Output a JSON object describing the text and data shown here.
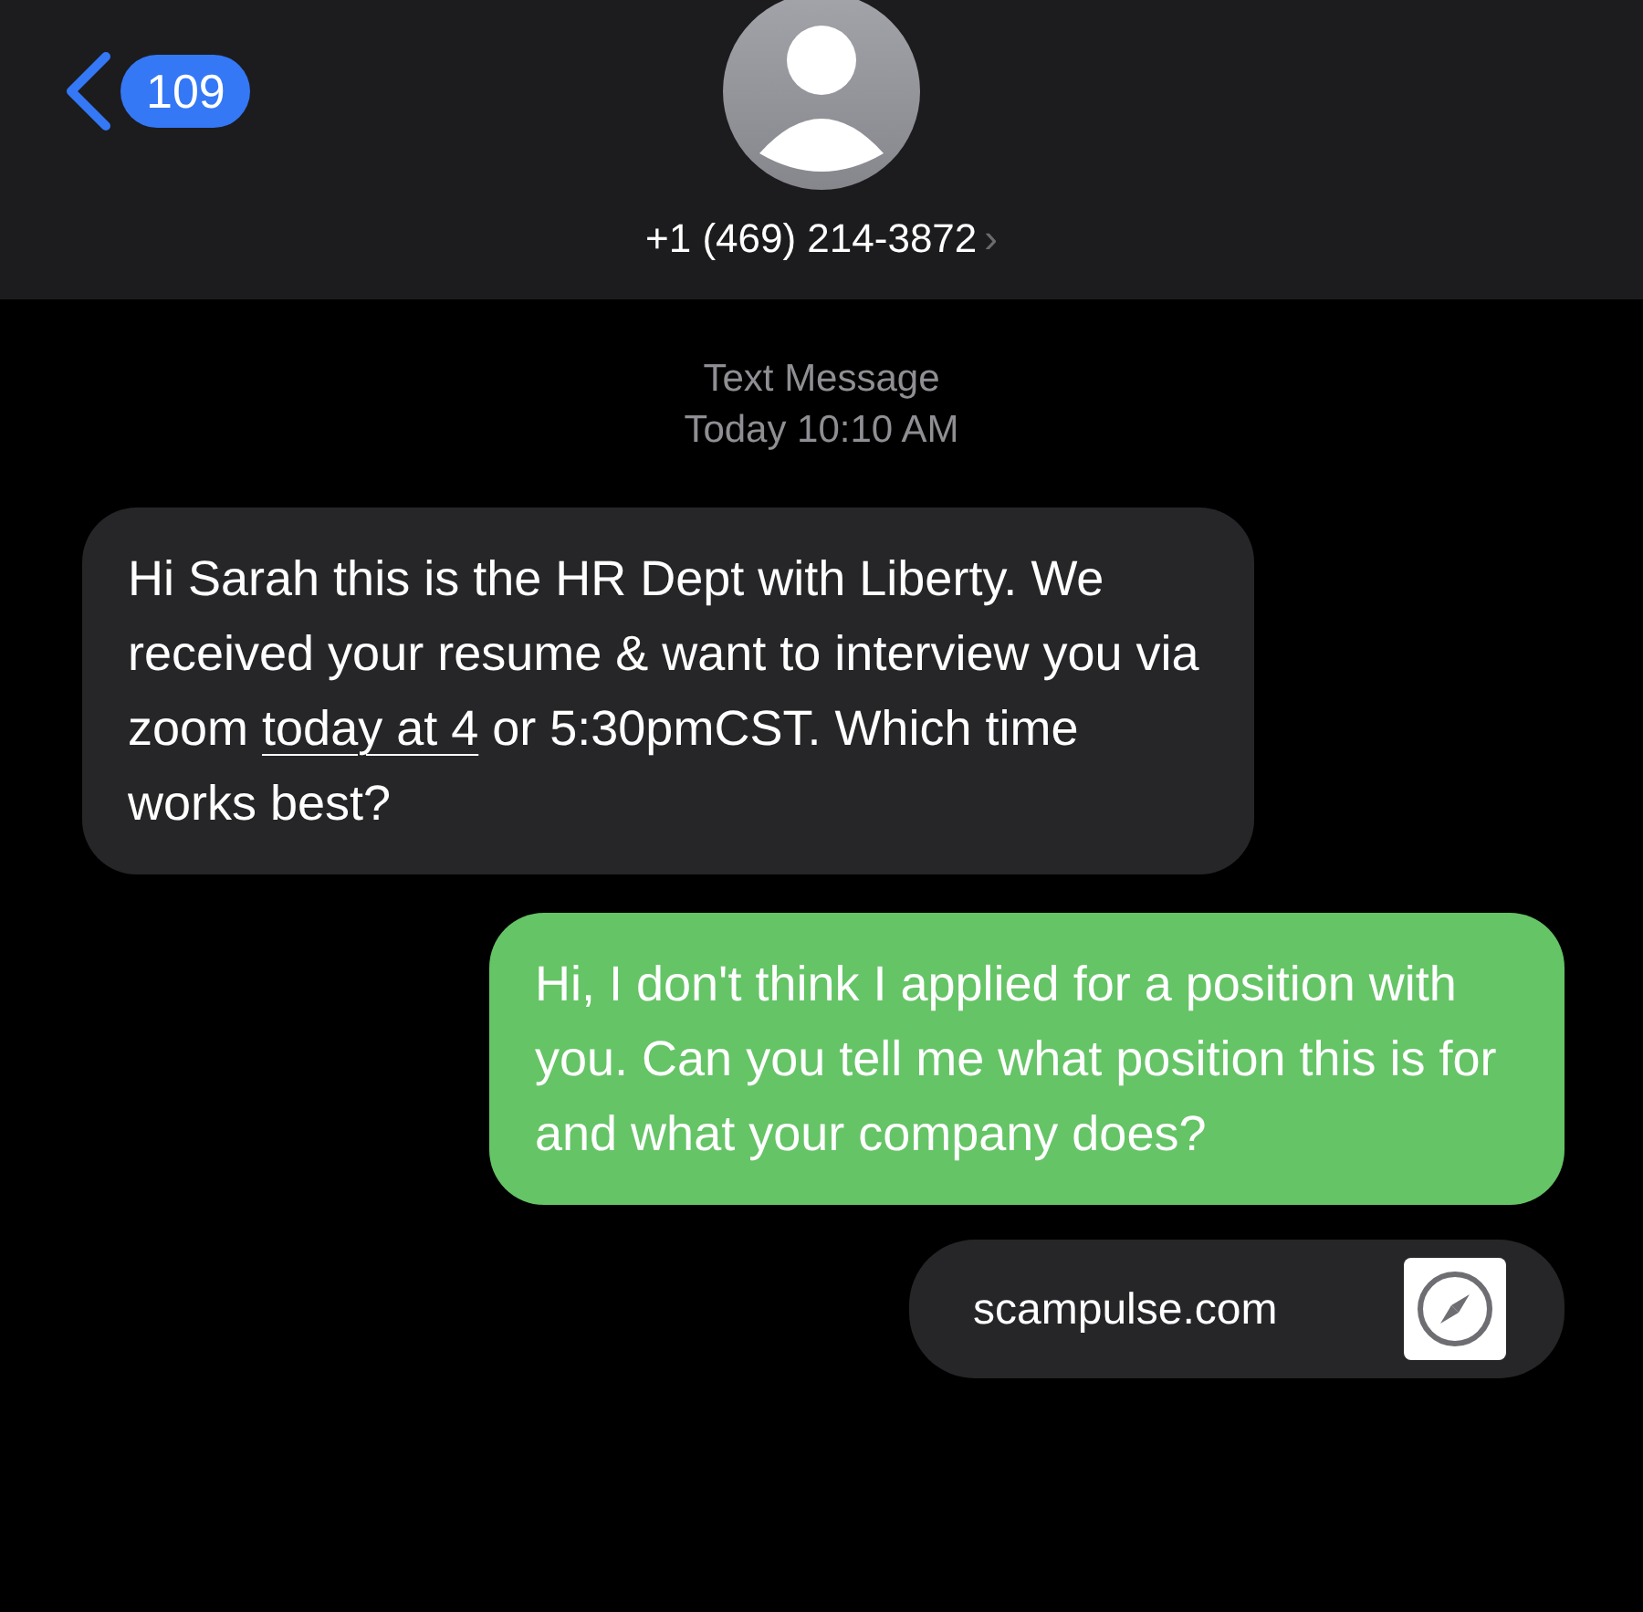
{
  "header": {
    "back_badge": "109",
    "contact": "+1 (469) 214-3872",
    "contact_chevron": "›"
  },
  "thread_info": {
    "service": "Text Message",
    "timestamp": "Today 10:10 AM"
  },
  "messages": [
    {
      "kind": "incoming",
      "parts": [
        {
          "text": "Hi Sarah this is the HR Dept with Liberty. We received your resume & want to interview you via zoom "
        },
        {
          "text": "today at 4",
          "link": true
        },
        {
          "text": " or 5:30pmCST. Which time works best?"
        }
      ]
    },
    {
      "kind": "outgoing",
      "parts": [
        {
          "text": "Hi, I don't think I applied for a position with you. Can you tell me what position this is for and what your company does?"
        }
      ]
    },
    {
      "kind": "link",
      "parts": [
        {
          "text": "scampulse.com"
        }
      ]
    }
  ]
}
